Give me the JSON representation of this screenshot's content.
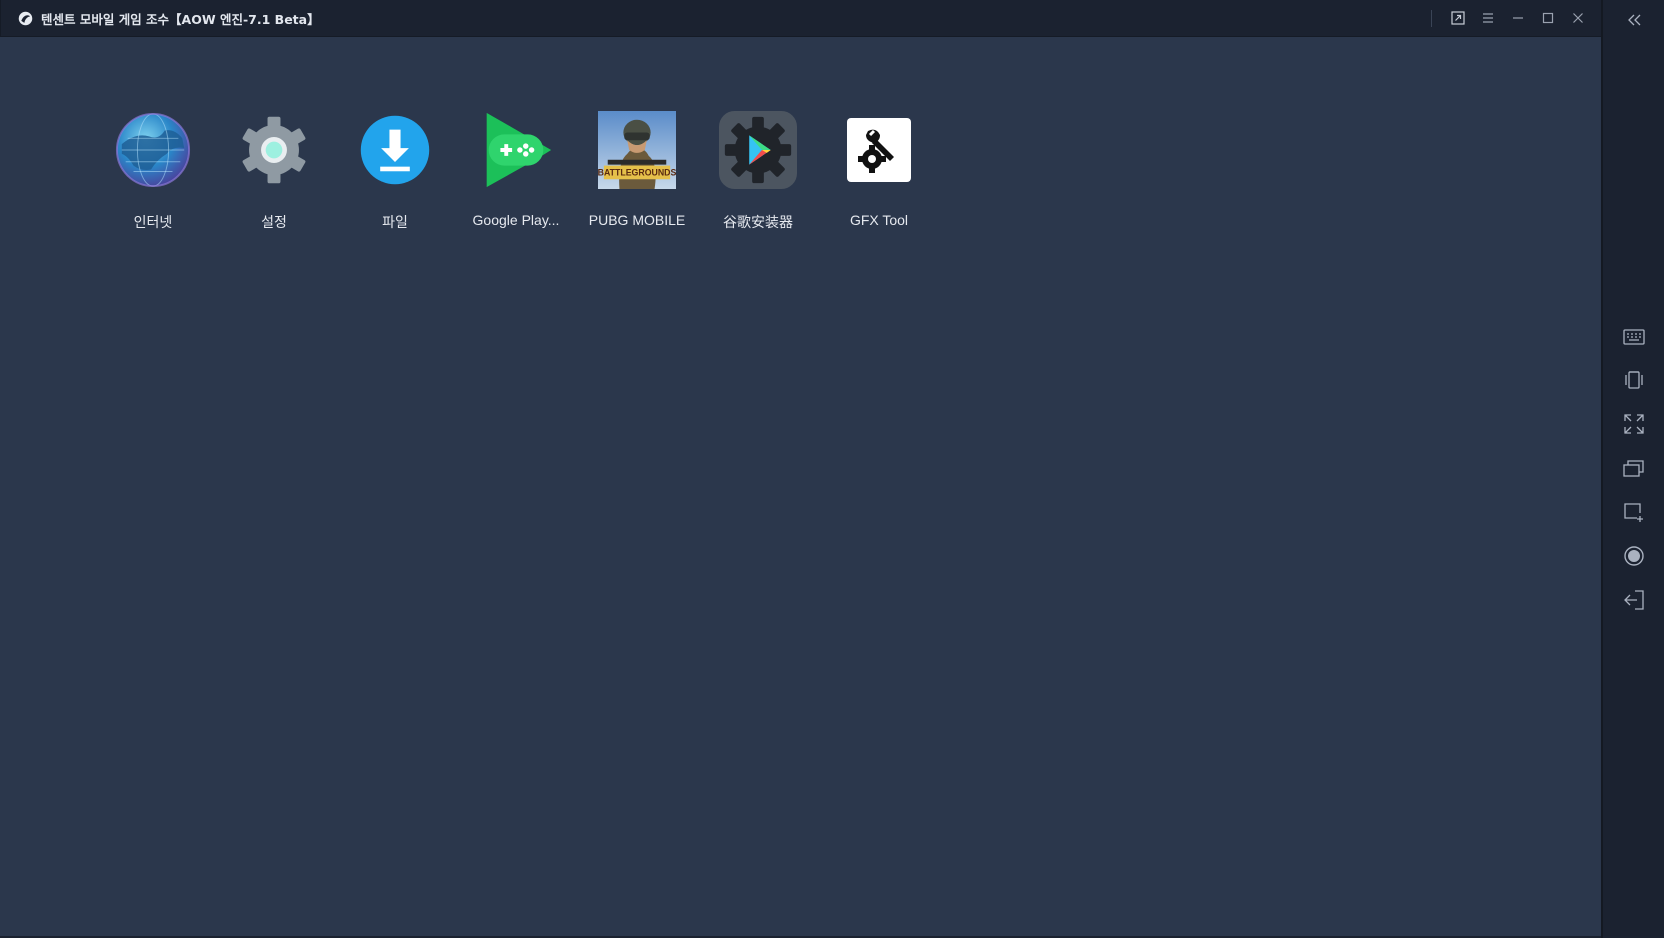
{
  "window": {
    "title": "텐센트 모바일 게임 조수【AOW 엔진-7.1 Beta】"
  },
  "titlebar": {
    "buttons": [
      "pin-window-icon",
      "menu-icon",
      "minimize-icon",
      "maximize-icon",
      "close-icon"
    ]
  },
  "apps": [
    {
      "label": "인터넷",
      "icon": "globe-icon"
    },
    {
      "label": "설정",
      "icon": "settings-gear-icon"
    },
    {
      "label": "파일",
      "icon": "download-icon"
    },
    {
      "label": "Google Play...",
      "icon": "google-play-games-icon"
    },
    {
      "label": "PUBG MOBILE",
      "icon": "pubg-mobile-icon"
    },
    {
      "label": "谷歌安装器",
      "icon": "google-installer-icon"
    },
    {
      "label": "GFX Tool",
      "icon": "gfx-tool-icon"
    }
  ],
  "sidebar": {
    "buttons": [
      "collapse-icon",
      "keyboard-icon",
      "shake-icon",
      "fullscreen-icon",
      "multi-window-icon",
      "add-screen-icon",
      "record-icon",
      "exit-icon"
    ]
  },
  "colors": {
    "background": "#2b374c",
    "titlebar": "#1b2230",
    "text": "#e6e9ef"
  }
}
